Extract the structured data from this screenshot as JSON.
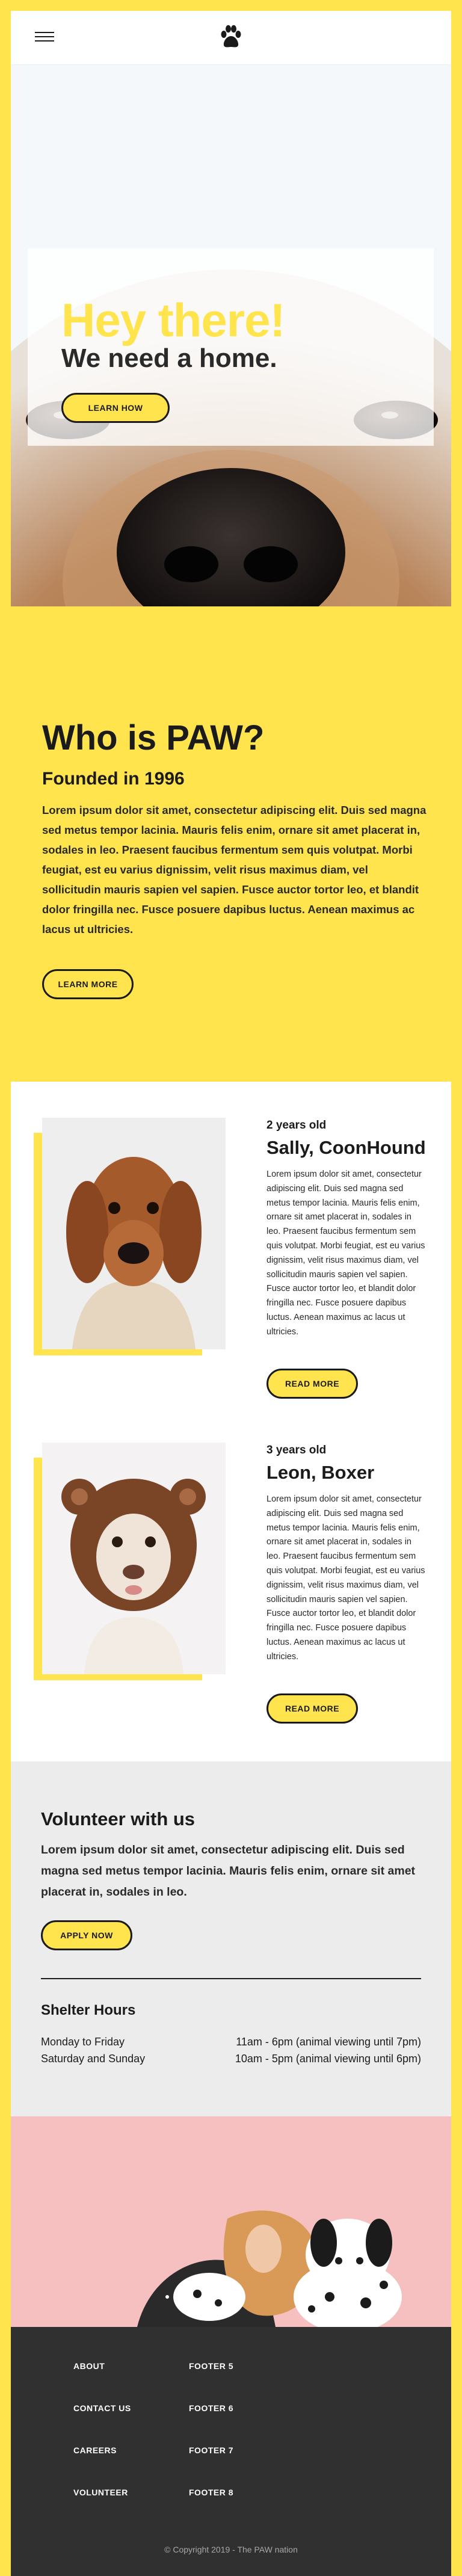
{
  "header": {
    "menu_icon": "hamburger-menu-icon",
    "logo_icon": "paw-print-icon"
  },
  "hero": {
    "title": "Hey there!",
    "subtitle": "We need a home.",
    "button_label": "LEARN HOW"
  },
  "about": {
    "title": "Who is PAW?",
    "subtitle": "Founded in 1996",
    "body": "Lorem ipsum dolor sit amet, consectetur adipiscing elit. Duis sed magna sed metus tempor lacinia. Mauris felis enim, ornare sit amet placerat in, sodales in leo. Praesent faucibus fermentum sem quis volutpat. Morbi feugiat, est eu varius dignissim, velit risus maximus diam, vel sollicitudin mauris sapien vel sapien. Fusce auctor tortor leo, et blandit dolor fringilla nec. Fusce posuere dapibus luctus. Aenean maximus ac lacus ut ultricies.",
    "button_label": "LEARN MORE"
  },
  "dogs": [
    {
      "age": "2 years old",
      "name": "Sally, CoonHound",
      "description": "Lorem ipsum dolor sit amet, consectetur adipiscing elit. Duis sed magna sed metus tempor lacinia. Mauris felis enim, ornare sit amet placerat in, sodales in leo. Praesent faucibus fermentum sem quis volutpat. Morbi feugiat, est eu varius dignissim, velit risus maximus diam, vel sollicitudin mauris sapien vel sapien. Fusce auctor tortor leo, et blandit dolor fringilla nec. Fusce posuere dapibus luctus. Aenean maximus ac lacus ut ultricies.",
      "button_label": "READ MORE"
    },
    {
      "age": "3 years old",
      "name": "Leon, Boxer",
      "description": "Lorem ipsum dolor sit amet, consectetur adipiscing elit. Duis sed magna sed metus tempor lacinia. Mauris felis enim, ornare sit amet placerat in, sodales in leo. Praesent faucibus fermentum sem quis volutpat. Morbi feugiat, est eu varius dignissim, velit risus maximus diam, vel sollicitudin mauris sapien vel sapien. Fusce auctor tortor leo, et blandit dolor fringilla nec. Fusce posuere dapibus luctus. Aenean maximus ac lacus ut ultricies.",
      "button_label": "READ MORE"
    }
  ],
  "volunteer": {
    "title": "Volunteer with us",
    "body": "Lorem ipsum dolor sit amet, consectetur adipiscing elit. Duis sed magna sed metus tempor lacinia. Mauris felis enim, ornare sit amet placerat in, sodales in leo.",
    "button_label": "APPLY NOW",
    "hours_title": "Shelter Hours",
    "hours": [
      {
        "day": "Monday to Friday",
        "time": "11am - 6pm (animal viewing until 7pm)"
      },
      {
        "day": "Saturday and Sunday",
        "time": "10am - 5pm (animal viewing until 6pm)"
      }
    ]
  },
  "footer": {
    "links_left": [
      "ABOUT",
      "CONTACT US",
      "CAREERS",
      "VOLUNTEER"
    ],
    "links_right": [
      "FOOTER 5",
      "FOOTER 6",
      "FOOTER 7",
      "FOOTER 8"
    ],
    "copyright": "© Copyright 2019 - The PAW nation"
  },
  "colors": {
    "brand_yellow": "#ffe44d",
    "text_dark": "#1b1b1b",
    "footer_bg": "#303030",
    "volunteer_bg": "#ececec",
    "photo_band_bg": "#f6bfc0"
  }
}
